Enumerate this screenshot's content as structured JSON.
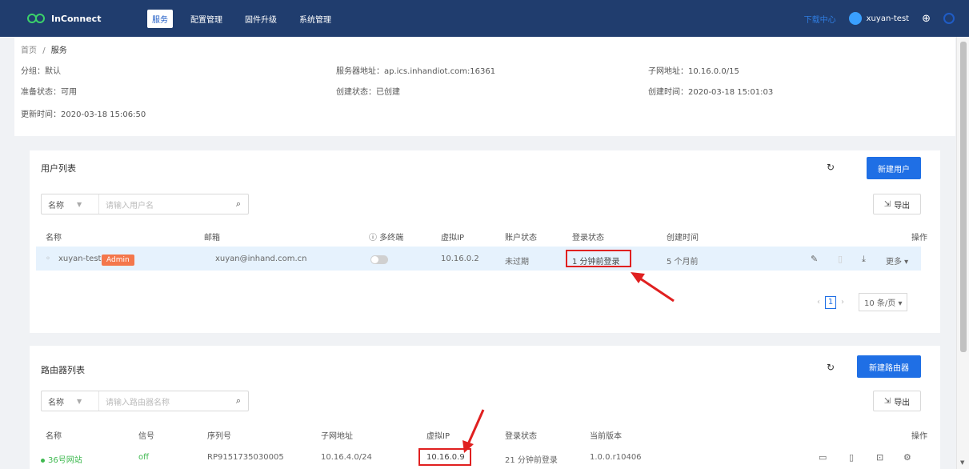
{
  "nav": {
    "brand": "InConnect",
    "items": [
      "服务",
      "配置管理",
      "固件升级",
      "系统管理"
    ],
    "doc_center": "下载中心",
    "username": "xuyan-test"
  },
  "breadcrumb": {
    "home": "首页",
    "sep": "/",
    "current": "服务"
  },
  "info": {
    "group": "分组：默认",
    "ready": "准备状态：可用",
    "updated": "更新时间：2020-03-18 15:06:50",
    "server": "服务器地址：ap.ics.inhandiot.com:16361",
    "create_state": "创建状态：已创建",
    "subnet": "子网地址：10.16.0.0/15",
    "created": "创建时间：2020-03-18 15:01:03"
  },
  "users": {
    "title": "用户列表",
    "new_btn": "新建用户",
    "export_btn": "导出",
    "search_field": "名称",
    "search_placeholder": "请输入用户名",
    "columns": [
      "名称",
      "邮箱",
      "多终端",
      "虚拟IP",
      "账户状态",
      "登录状态",
      "创建时间",
      "操作"
    ],
    "rows": [
      {
        "name": "xuyan-test",
        "tag": "Admin",
        "email": "xuyan@inhand.com.cn",
        "vip": "10.16.0.2",
        "account": "未过期",
        "login": "1 分钟前登录",
        "created": "5 个月前",
        "more": "更多"
      }
    ],
    "pager": {
      "current": "1",
      "page_size": "10 条/页"
    }
  },
  "routers": {
    "title": "路由器列表",
    "new_btn": "新建路由器",
    "export_btn": "导出",
    "search_field": "名称",
    "search_placeholder": "请输入路由器名称",
    "columns": [
      "名称",
      "信号",
      "序列号",
      "子网地址",
      "虚拟IP",
      "登录状态",
      "当前版本",
      "操作"
    ],
    "rows": [
      {
        "name": "36号网站",
        "signal": "off",
        "serial": "RP9151735030005",
        "subnet": "10.16.4.0/24",
        "vip": "10.16.0.9",
        "login": "21 分钟前登录",
        "version": "1.0.0.r10406"
      }
    ]
  },
  "colors": {
    "nav_bg": "#203d6e",
    "primary": "#1f6fe5",
    "admin_tag": "#f4774b",
    "highlight_box": "#e02020"
  }
}
